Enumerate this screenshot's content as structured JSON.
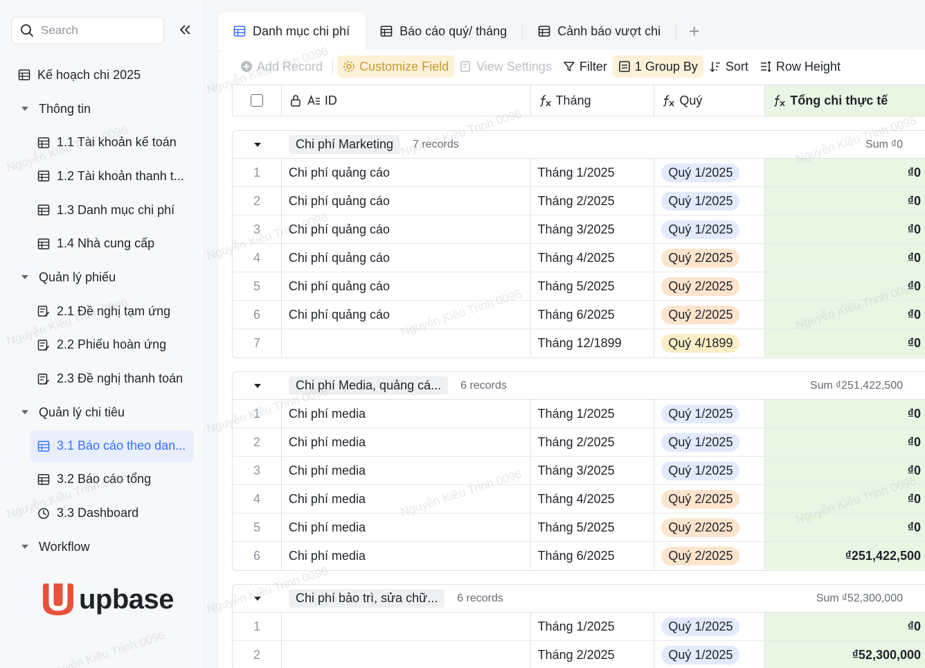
{
  "sidebar": {
    "search_placeholder": "Search",
    "items": [
      {
        "label": "Kế hoạch chi 2025",
        "level": 0,
        "kind": "table"
      },
      {
        "label": "Thông tin",
        "level": 0,
        "kind": "folder"
      },
      {
        "label": "1.1 Tài khoản kế toán",
        "level": 1,
        "kind": "table"
      },
      {
        "label": "1.2 Tài khoản thanh t...",
        "level": 1,
        "kind": "table"
      },
      {
        "label": "1.3 Danh mục chi phí",
        "level": 1,
        "kind": "table"
      },
      {
        "label": "1.4 Nhà cung cấp",
        "level": 1,
        "kind": "table"
      },
      {
        "label": "Quản lý phiếu",
        "level": 0,
        "kind": "folder"
      },
      {
        "label": "2.1 Đề nghị tạm ứng",
        "level": 1,
        "kind": "form"
      },
      {
        "label": "2.2 Phiếu hoàn ứng",
        "level": 1,
        "kind": "form"
      },
      {
        "label": "2.3 Đề nghị thanh toán",
        "level": 1,
        "kind": "form"
      },
      {
        "label": "Quản lý chi tiêu",
        "level": 0,
        "kind": "folder"
      },
      {
        "label": "3.1 Báo cáo theo dan...",
        "level": 1,
        "kind": "table",
        "active": true
      },
      {
        "label": "3.2 Báo cáo tổng",
        "level": 1,
        "kind": "table"
      },
      {
        "label": "3.3 Dashboard",
        "level": 1,
        "kind": "dashboard"
      },
      {
        "label": "Workflow",
        "level": 0,
        "kind": "folder"
      }
    ],
    "logo_text": "upbase"
  },
  "tabs": [
    {
      "label": "Danh mục chi phí",
      "active": true
    },
    {
      "label": "Báo cáo quý/ tháng",
      "active": false
    },
    {
      "label": "Cảnh báo vượt chi",
      "active": false
    }
  ],
  "toolbar": {
    "add_record": "Add Record",
    "customize_field": "Customize Field",
    "view_settings": "View Settings",
    "filter": "Filter",
    "group_by": "1 Group By",
    "sort": "Sort",
    "row_height": "Row Height"
  },
  "columns": {
    "id": "ID",
    "month": "Tháng",
    "quarter": "Quý",
    "total": "Tổng chi thực tế"
  },
  "groups": [
    {
      "name": "Chi phí Marketing",
      "count": "7 records",
      "sum_label": "Sum",
      "sum_value": "₫0",
      "rows": [
        {
          "n": "1",
          "id": "Chi phí quảng cáo",
          "month": "Tháng 1/2025",
          "quarter": "Quý 1/2025",
          "q": "q1",
          "total": "₫0"
        },
        {
          "n": "2",
          "id": "Chi phí quảng cáo",
          "month": "Tháng 2/2025",
          "quarter": "Quý 1/2025",
          "q": "q1",
          "total": "₫0"
        },
        {
          "n": "3",
          "id": "Chi phí quảng cáo",
          "month": "Tháng 3/2025",
          "quarter": "Quý 1/2025",
          "q": "q1",
          "total": "₫0"
        },
        {
          "n": "4",
          "id": "Chi phí quảng cáo",
          "month": "Tháng 4/2025",
          "quarter": "Quý 2/2025",
          "q": "q2",
          "total": "₫0"
        },
        {
          "n": "5",
          "id": "Chi phí quảng cáo",
          "month": "Tháng 5/2025",
          "quarter": "Quý 2/2025",
          "q": "q2",
          "total": "₫0"
        },
        {
          "n": "6",
          "id": "Chi phí quảng cáo",
          "month": "Tháng 6/2025",
          "quarter": "Quý 2/2025",
          "q": "q2",
          "total": "₫0"
        },
        {
          "n": "7",
          "id": "",
          "month": "Tháng 12/1899",
          "quarter": "Quý 4/1899",
          "q": "q4",
          "total": "₫0"
        }
      ]
    },
    {
      "name": "Chi phí Media, quảng cá...",
      "count": "6 records",
      "sum_label": "Sum",
      "sum_value": "₫251,422,500",
      "rows": [
        {
          "n": "1",
          "id": "Chi phí media",
          "month": "Tháng 1/2025",
          "quarter": "Quý 1/2025",
          "q": "q1",
          "total": "₫0"
        },
        {
          "n": "2",
          "id": "Chi phí media",
          "month": "Tháng 2/2025",
          "quarter": "Quý 1/2025",
          "q": "q1",
          "total": "₫0"
        },
        {
          "n": "3",
          "id": "Chi phí media",
          "month": "Tháng 3/2025",
          "quarter": "Quý 1/2025",
          "q": "q1",
          "total": "₫0"
        },
        {
          "n": "4",
          "id": "Chi phí media",
          "month": "Tháng 4/2025",
          "quarter": "Quý 2/2025",
          "q": "q2",
          "total": "₫0"
        },
        {
          "n": "5",
          "id": "Chi phí media",
          "month": "Tháng 5/2025",
          "quarter": "Quý 2/2025",
          "q": "q2",
          "total": "₫0"
        },
        {
          "n": "6",
          "id": "Chi phí media",
          "month": "Tháng 6/2025",
          "quarter": "Quý 2/2025",
          "q": "q2",
          "total": "₫251,422,500"
        }
      ]
    },
    {
      "name": "Chi phí bảo trì, sửa chữ...",
      "count": "6 records",
      "sum_label": "Sum",
      "sum_value": "₫52,300,000",
      "rows": [
        {
          "n": "1",
          "id": "",
          "month": "Tháng 1/2025",
          "quarter": "Quý 1/2025",
          "q": "q1",
          "total": "₫0"
        },
        {
          "n": "2",
          "id": "",
          "month": "Tháng 2/2025",
          "quarter": "Quý 1/2025",
          "q": "q1",
          "total": "₫52,300,000"
        }
      ]
    }
  ],
  "watermark": "Nguyễn Kiều Trinh 0096",
  "colors": {
    "accent": "#3370ff",
    "total_bg": "#e8f7e3",
    "q1": "#e1eaff",
    "q2": "#fde4cc",
    "q4": "#fbeec6",
    "logo": "#e8513a"
  }
}
